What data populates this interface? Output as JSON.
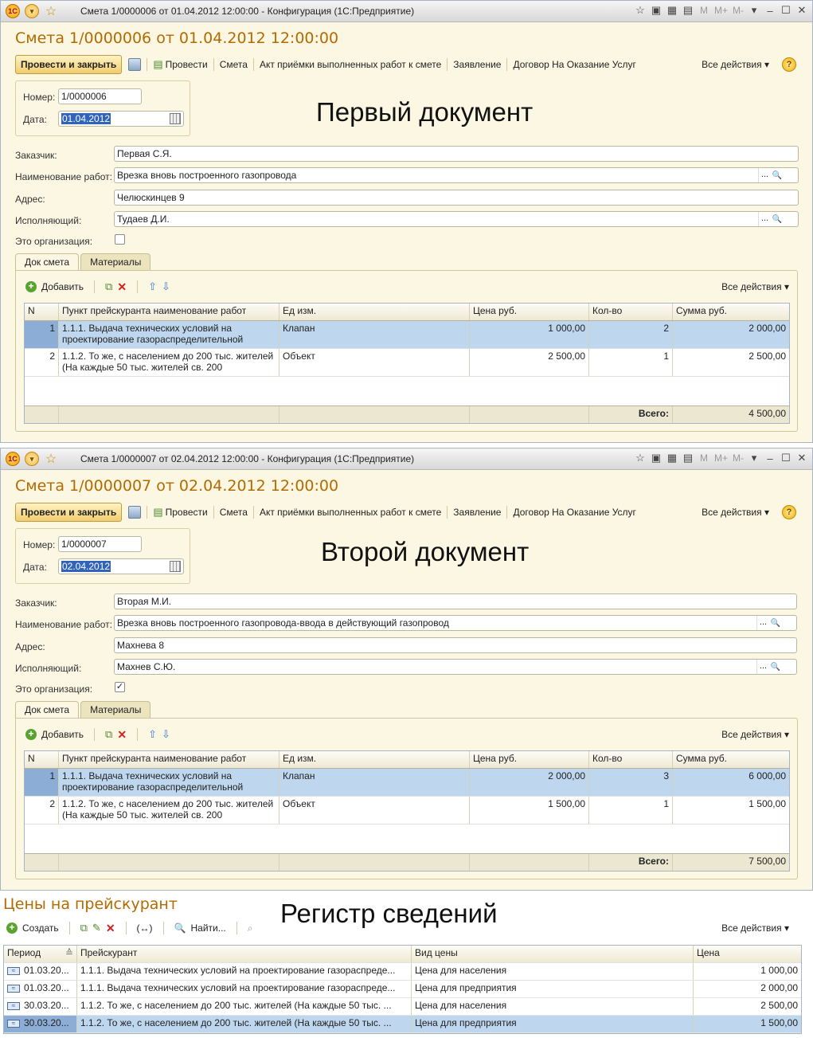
{
  "doc1": {
    "window_title": "Смета 1/0000006 от 01.04.2012 12:00:00 - Конфигурация  (1С:Предприятие)",
    "header": "Смета 1/0000006 от 01.04.2012 12:00:00",
    "caption": "Первый документ",
    "number": "1/0000006",
    "date": "01.04.2012",
    "customer": "Первая С.Я.",
    "work_name": "Врезка вновь построенного газопровода",
    "address": "Челюскинцев 9",
    "executor": "Тудаев Д.И.",
    "is_org": false,
    "rows": [
      {
        "n": "1",
        "item": "1.1.1. Выдача технических условий на проектирование газораспределительной",
        "unit": "Клапан",
        "price": "1 000,00",
        "qty": "2",
        "sum": "2 000,00"
      },
      {
        "n": "2",
        "item": "1.1.2. То же, с населением до 200 тыс. жителей (На каждые 50 тыс. жителей св. 200",
        "unit": "Объект",
        "price": "2 500,00",
        "qty": "1",
        "sum": "2 500,00"
      }
    ],
    "total": "4 500,00"
  },
  "doc2": {
    "window_title": "Смета 1/0000007 от 02.04.2012 12:00:00 - Конфигурация  (1С:Предприятие)",
    "header": "Смета 1/0000007 от 02.04.2012 12:00:00",
    "caption": "Второй документ",
    "number": "1/0000007",
    "date": "02.04.2012",
    "customer": "Вторая М.И.",
    "work_name": "Врезка вновь построенного газопровода-ввода в действующий газопровод",
    "address": "Махнева 8",
    "executor": "Махнев С.Ю.",
    "is_org": true,
    "rows": [
      {
        "n": "1",
        "item": "1.1.1. Выдача технических условий на проектирование газораспределительной",
        "unit": "Клапан",
        "price": "2 000,00",
        "qty": "3",
        "sum": "6 000,00"
      },
      {
        "n": "2",
        "item": "1.1.2. То же, с населением до 200 тыс. жителей (На каждые 50 тыс. жителей св. 200",
        "unit": "Объект",
        "price": "1 500,00",
        "qty": "1",
        "sum": "1 500,00"
      }
    ],
    "total": "7 500,00"
  },
  "labels": {
    "post_close": "Провести и закрыть",
    "post": "Провести",
    "links": [
      "Смета",
      "Акт приёмки выполненных работ к смете",
      "Заявление",
      "Договор На Оказание Услуг"
    ],
    "all_actions": "Все действия ▾",
    "number": "Номер:",
    "date": "Дата:",
    "customer": "Заказчик:",
    "work_name": "Наименование работ:",
    "address": "Адрес:",
    "executor": "Исполняющий:",
    "is_org": "Это организация:",
    "tab1": "Док смета",
    "tab2": "Материалы",
    "add": "Добавить",
    "cols": [
      "N",
      "Пункт прейскуранта наименование работ",
      "Ед изм.",
      "Цена руб.",
      "Кол-во",
      "Сумма руб."
    ],
    "total": "Всего:",
    "tb_m": [
      "M",
      "M+",
      "M-"
    ]
  },
  "register": {
    "title": "Цены на прейскурант",
    "caption": "Регистр сведений",
    "create": "Создать",
    "find": "Найти...",
    "all_actions": "Все действия ▾",
    "cols": [
      "Период",
      "Прейскурант",
      "Вид цены",
      "Цена"
    ],
    "rows": [
      {
        "period": "01.03.20...",
        "item": "1.1.1. Выдача технических условий на проектирование газораспреде...",
        "kind": "Цена для населения",
        "price": "1 000,00"
      },
      {
        "period": "01.03.20...",
        "item": "1.1.1. Выдача технических условий на проектирование газораспреде...",
        "kind": "Цена для предприятия",
        "price": "2 000,00"
      },
      {
        "period": "30.03.20...",
        "item": "1.1.2. То же, с населением до 200 тыс. жителей (На каждые 50 тыс. ...",
        "kind": "Цена для населения",
        "price": "2 500,00"
      },
      {
        "period": "30.03.20...",
        "item": "1.1.2. То же, с населением до 200 тыс. жителей (На каждые 50 тыс. ...",
        "kind": "Цена для предприятия",
        "price": "1 500,00"
      }
    ]
  }
}
